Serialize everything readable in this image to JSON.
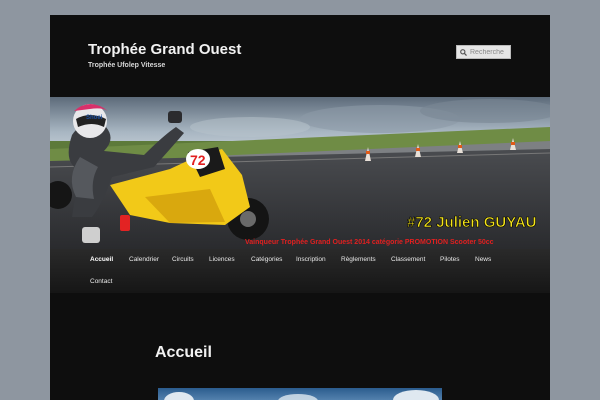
{
  "site": {
    "title": "Trophée Grand Ouest",
    "description": "Trophée Ufolep Vitesse"
  },
  "search": {
    "placeholder": "Recherche",
    "icon": "search-icon"
  },
  "banner": {
    "rider_number": "72",
    "caption_main": "#72 Julien GUYAU",
    "caption_sub": "Vainqueur Trophée Grand Ouest 2014 catégorie PROMOTION Scooter 50cc",
    "colors": {
      "caption_main": "#f5e51a",
      "caption_sub": "#e02020",
      "bike": "#f2c918"
    }
  },
  "nav": {
    "items": [
      {
        "label": "Accueil",
        "active": true
      },
      {
        "label": "Calendrier"
      },
      {
        "label": "Circuits"
      },
      {
        "label": "Licences"
      },
      {
        "label": "Catégories"
      },
      {
        "label": "Inscription"
      },
      {
        "label": "Règlements"
      },
      {
        "label": "Classement"
      },
      {
        "label": "Pilotes"
      },
      {
        "label": "News"
      },
      {
        "label": "Contact"
      }
    ]
  },
  "main": {
    "heading": "Accueil"
  },
  "colors": {
    "page_bg": "#8e96a0",
    "site_bg": "#0e0e0e",
    "nav_bg": "#222222",
    "text": "#f2f2f2"
  }
}
